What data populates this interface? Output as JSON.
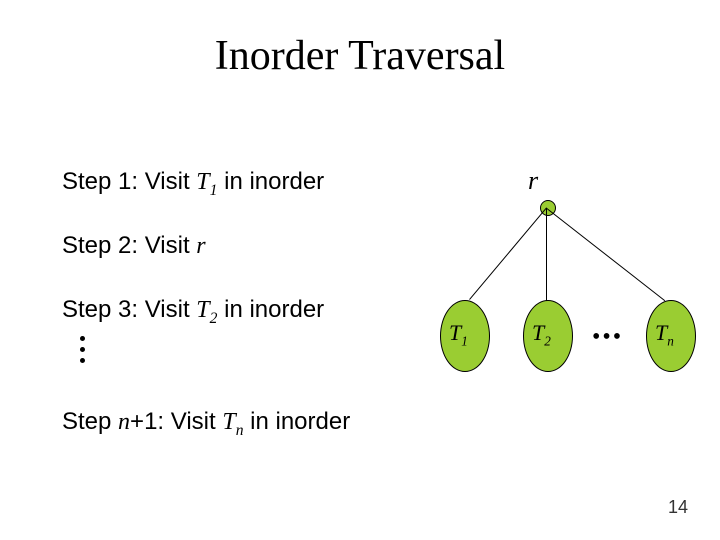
{
  "title": "Inorder Traversal",
  "steps": {
    "s1_a": "Step 1: Visit ",
    "s1_T": "T",
    "s1_sub": "1",
    "s1_b": " in inorder",
    "s2_a": "Step 2: Visit ",
    "s2_r": "r",
    "s3_a": "Step 3: Visit ",
    "s3_T": "T",
    "s3_sub": "2",
    "s3_b": " in inorder",
    "sN_a": "Step ",
    "sN_n": "n",
    "sN_plus": "+1: Visit ",
    "sN_T": "T",
    "sN_sub": "n",
    "sN_b": " in inorder"
  },
  "diagram": {
    "root_label": "r",
    "leaves": {
      "t1": "T",
      "t1s": "1",
      "t2": "T",
      "t2s": "2",
      "tn": "T",
      "tns": "n"
    },
    "dots": "•••"
  },
  "page": "14"
}
